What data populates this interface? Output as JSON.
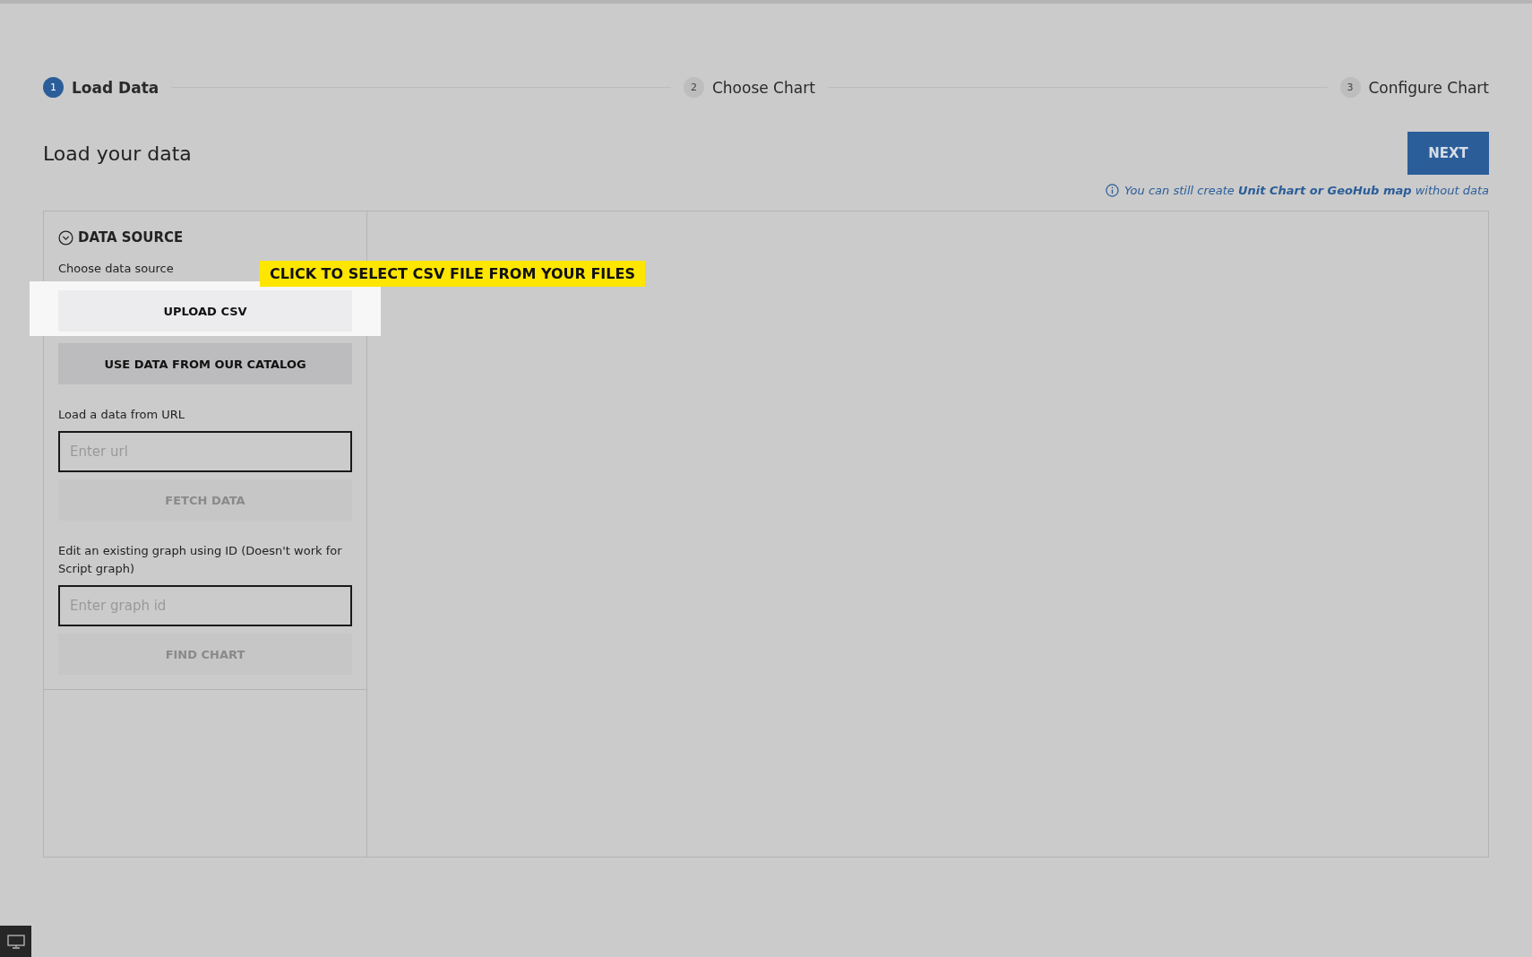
{
  "steps": [
    {
      "number": "1",
      "label": "Load Data",
      "selected": true
    },
    {
      "number": "2",
      "label": "Choose Chart",
      "selected": false
    },
    {
      "number": "3",
      "label": "Configure Chart",
      "selected": false
    }
  ],
  "heading": "Load your data",
  "next_button": {
    "label": "NEXT"
  },
  "info_note": "You can still create **Unit Chart or GeoHub map** without data",
  "data_source": {
    "title": "DATA SOURCE",
    "expanded": true,
    "choose_label": "Choose data source",
    "source_buttons": [
      {
        "label": "UPLOAD CSV",
        "highlighted": true
      },
      {
        "label": "USE DATA FROM OUR CATALOG",
        "highlighted": false
      }
    ],
    "url_label": "Load a data from URL",
    "url_placeholder": "Enter url",
    "fetch_button": {
      "label": "FETCH DATA",
      "disabled": true
    },
    "graph_label": "Edit an existing graph using ID (Doesn't work for Script graph)",
    "graph_placeholder": "Enter graph id",
    "find_button": {
      "label": "FIND CHART",
      "disabled": true
    }
  },
  "tour_tooltip": "CLICK TO SELECT CSV FILE FROM YOUR FILES"
}
